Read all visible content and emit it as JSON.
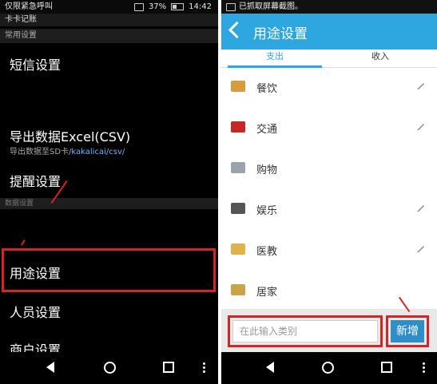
{
  "left": {
    "status": {
      "text": "仅限紧急呼叫",
      "battery": "37%",
      "time": "14:42"
    },
    "app_title": "卡卡记账",
    "section_common": "常用设置",
    "menu": [
      {
        "label": "短信设置"
      },
      {
        "label": "导出数据Excel(CSV)",
        "sub_prefix": "导出数据至SD卡/",
        "sub_path": "kakalicai/csv/"
      },
      {
        "label": "提醒设置"
      },
      {
        "label": "用途设置"
      },
      {
        "label": "人员设置"
      },
      {
        "label": "商户设置"
      }
    ],
    "section_data": "数据设置"
  },
  "right": {
    "status": {
      "text": "已抓取屏幕截图。"
    },
    "header": {
      "title": "用途设置"
    },
    "tabs": [
      "支出",
      "收入"
    ],
    "items": [
      {
        "label": "餐饮",
        "icon": "food-icon",
        "color": "#d89a3a",
        "editable": true
      },
      {
        "label": "交通",
        "icon": "bus-icon",
        "color": "#c62828",
        "editable": true
      },
      {
        "label": "购物",
        "icon": "cart-icon",
        "color": "#9aa3ab",
        "editable": false
      },
      {
        "label": "娱乐",
        "icon": "entertainment-icon",
        "color": "#555555",
        "editable": true
      },
      {
        "label": "医教",
        "icon": "book-icon",
        "color": "#e0b24a",
        "editable": true
      },
      {
        "label": "居家",
        "icon": "house-icon",
        "color": "#caa24a",
        "editable": false
      }
    ],
    "input_placeholder": "在此输入类别",
    "add_button": "新增"
  },
  "colors": {
    "accent": "#2ea7e0",
    "highlight": "#d62323",
    "button": "#2e8ec9"
  }
}
